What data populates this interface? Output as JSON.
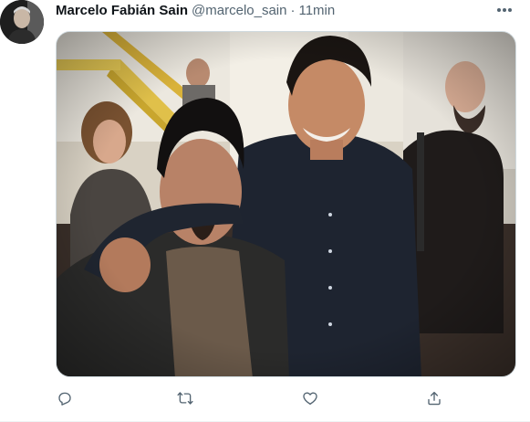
{
  "tweet": {
    "author": {
      "display_name": "Marcelo Fabián Sain",
      "handle": "@marcelo_sain"
    },
    "separator": "·",
    "time": "11min"
  },
  "media": {
    "kind": "photo",
    "description_icon": "photo"
  },
  "icons": {
    "more": "more-horizontal-icon",
    "reply": "reply-icon",
    "retweet": "retweet-icon",
    "like": "heart-icon",
    "share": "share-icon"
  },
  "colors": {
    "text_primary": "#0f1419",
    "text_secondary": "#536471",
    "border": "#cfd9de"
  }
}
